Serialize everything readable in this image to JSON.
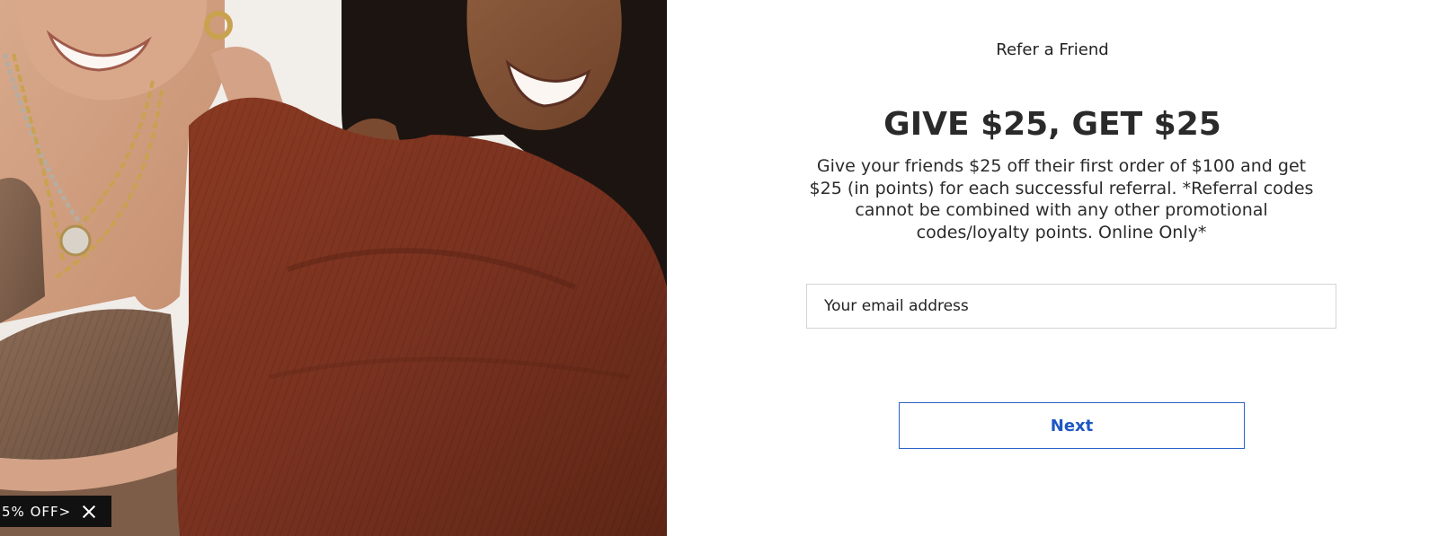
{
  "promo": {
    "label": "5% OFF>",
    "close_icon": "close-icon"
  },
  "referral": {
    "eyebrow": "Refer a Friend",
    "headline": "GIVE $25, GET $25",
    "description": "Give your friends $25 off their first order of $100 and get $25 (in points) for each successful referral. *Referral codes cannot be combined with any other promotional codes/loyalty points. Online Only*",
    "email_placeholder": "Your email address",
    "next_label": "Next"
  },
  "colors": {
    "accent": "#1e56c4",
    "text": "#2a2a2a",
    "sweater": "#7a3220",
    "promo_bg": "#111111"
  }
}
